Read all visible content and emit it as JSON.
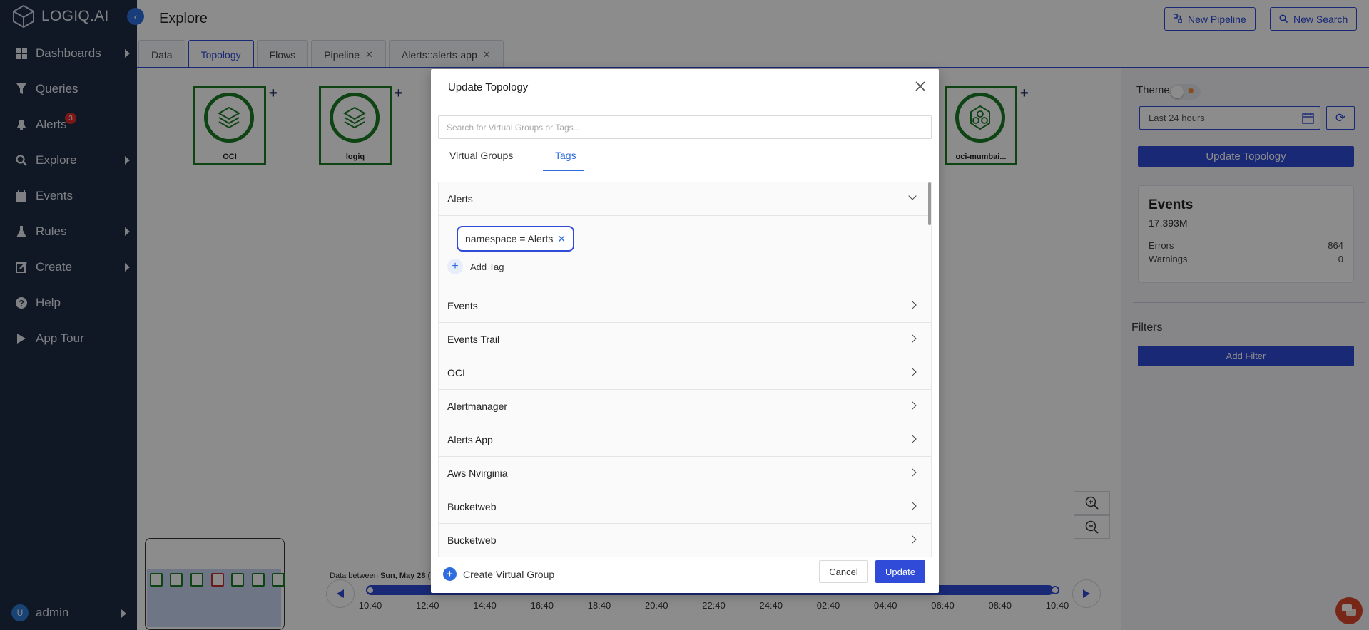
{
  "app": {
    "logo_text": "LOGIQ.AI"
  },
  "sidebar": {
    "items": [
      {
        "label": "Dashboards",
        "icon": "grid-icon",
        "has_arrow": true
      },
      {
        "label": "Queries",
        "icon": "filter-icon",
        "has_arrow": false
      },
      {
        "label": "Alerts",
        "icon": "bell-icon",
        "has_arrow": false,
        "badge": "3"
      },
      {
        "label": "Explore",
        "icon": "search-icon",
        "has_arrow": true
      },
      {
        "label": "Events",
        "icon": "calendar-icon",
        "has_arrow": false
      },
      {
        "label": "Rules",
        "icon": "flask-icon",
        "has_arrow": true
      },
      {
        "label": "Create",
        "icon": "edit-icon",
        "has_arrow": true
      },
      {
        "label": "Help",
        "icon": "question-icon",
        "has_arrow": false
      },
      {
        "label": "App Tour",
        "icon": "play-icon",
        "has_arrow": false
      }
    ],
    "user": {
      "initial": "U",
      "name": "admin"
    }
  },
  "header": {
    "title": "Explore",
    "new_pipeline": "New Pipeline",
    "new_search": "New Search"
  },
  "tabs": [
    {
      "label": "Data",
      "closable": false
    },
    {
      "label": "Topology",
      "closable": false,
      "active": true
    },
    {
      "label": "Flows",
      "closable": false
    },
    {
      "label": "Pipeline",
      "closable": true
    },
    {
      "label": "Alerts::alerts-app",
      "closable": true
    }
  ],
  "topology": {
    "nodes": [
      {
        "label": "OCI"
      },
      {
        "label": "logiq"
      },
      {
        "label": "oci-mumbai..."
      }
    ]
  },
  "right_panel": {
    "theme_label": "Theme",
    "time_range": "Last 24 hours",
    "update_button": "Update Topology",
    "events": {
      "title": "Events",
      "total": "17.393M",
      "errors_label": "Errors",
      "errors_value": "864",
      "warnings_label": "Warnings",
      "warnings_value": "0"
    },
    "filters_label": "Filters",
    "add_filter": "Add Filter"
  },
  "timeline": {
    "data_between_prefix": "Data between",
    "data_between_value": "Sun, May 28 (",
    "ticks": [
      "10:40",
      "12:40",
      "14:40",
      "16:40",
      "18:40",
      "20:40",
      "22:40",
      "24:40",
      "02:40",
      "04:40",
      "06:40",
      "08:40",
      "10:40"
    ]
  },
  "modal": {
    "title": "Update Topology",
    "search_placeholder": "Search for Virtual Groups or Tags...",
    "tabs": {
      "virtual_groups": "Virtual Groups",
      "tags": "Tags"
    },
    "open_group": {
      "label": "Alerts",
      "tag": "namespace = Alerts",
      "add_tag": "Add Tag"
    },
    "groups": [
      "Events",
      "Events Trail",
      "OCI",
      "Alertmanager",
      "Alerts App",
      "Aws Nvirginia",
      "Bucketweb",
      "Bucketweb"
    ],
    "create_virtual_group": "Create Virtual Group",
    "cancel": "Cancel",
    "update": "Update"
  },
  "colors": {
    "sidebar_bg": "#1e2a44",
    "accent": "#2f4bd8",
    "node_green": "#1b7a24",
    "badge_red": "#e02b2b"
  }
}
